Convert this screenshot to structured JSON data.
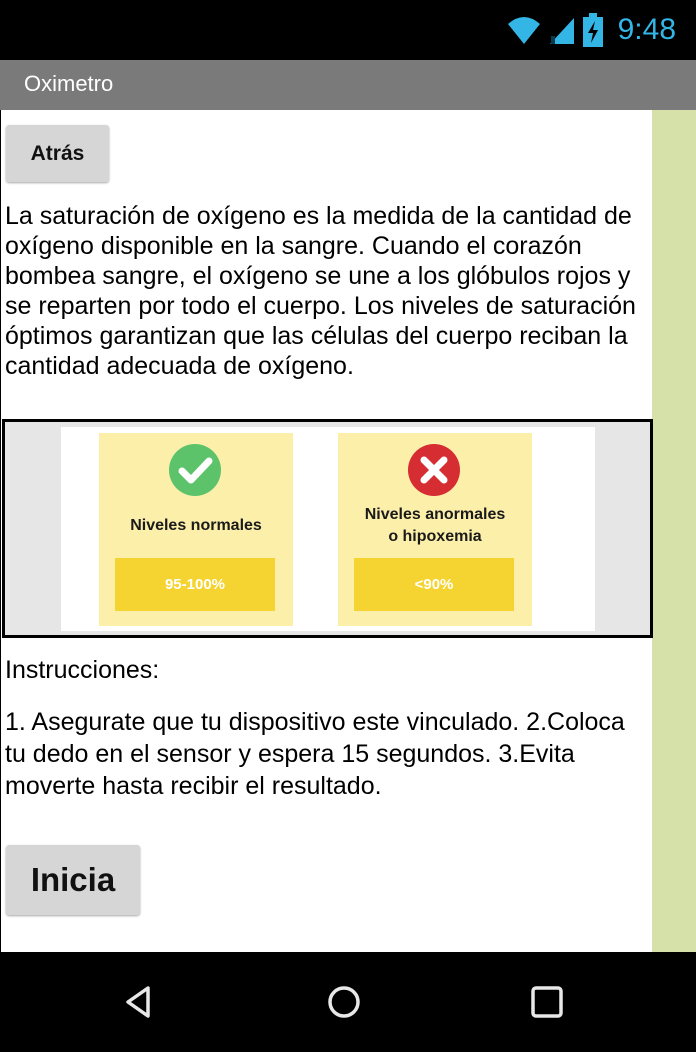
{
  "status_bar": {
    "time": "9:48",
    "icons": [
      "wifi-icon",
      "signal-icon",
      "battery-charging-icon"
    ],
    "accent_color": "#33b5e5"
  },
  "app_bar": {
    "title": "Oximetro",
    "color": "#7a7a7a"
  },
  "screen": {
    "back_button_label": "Atrás",
    "description": "La saturación de oxígeno es la medida de la cantidad de oxígeno disponible en la sangre. Cuando el corazón bombea sangre, el oxígeno se une a los glóbulos rojos y se reparten por todo el cuerpo. Los niveles de saturación óptimos garantizan que las células del cuerpo reciban la cantidad adecuada de oxígeno.",
    "levels_image": {
      "normal": {
        "icon": "check-icon",
        "label": "Niveles normales",
        "range": "95-100%"
      },
      "abnormal": {
        "icon": "x-icon",
        "label_line1": "Niveles anormales",
        "label_line2": "o hipoxemia",
        "range": "<90%"
      }
    },
    "instructions_heading": "Instrucciones:",
    "instructions_text": "1. Asegurate que tu dispositivo este vinculado. 2.Coloca tu dedo en el sensor y espera 15 segundos. 3.Evita moverte hasta recibir el resultado.",
    "start_button_label": "Inicia"
  },
  "nav_bar": {
    "icons": [
      "back-triangle-icon",
      "home-circle-icon",
      "recent-apps-square-icon"
    ]
  }
}
